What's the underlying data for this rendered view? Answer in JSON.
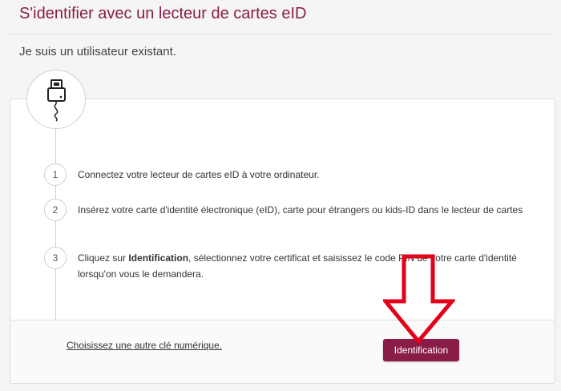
{
  "header": {
    "title": "S'identifier avec un lecteur de cartes eID",
    "subtitle": "Je suis un utilisateur existant."
  },
  "steps": [
    {
      "number": "1",
      "text": "Connectez votre lecteur de cartes eID à votre ordinateur."
    },
    {
      "number": "2",
      "text": "Insérez votre carte d'identité électronique (eID), carte pour étrangers ou kids-ID dans le lecteur de cartes"
    },
    {
      "number": "3",
      "text_before": "Cliquez sur ",
      "text_bold": "Identification",
      "text_after": ", sélectionnez votre certificat et saisissez le code PIN de votre carte d'identité lorsqu'on vous le demandera."
    }
  ],
  "footer": {
    "alt_link": "Choisissez une autre clé numérique.",
    "identify_button": "Identification"
  },
  "icons": {
    "card_reader": "card-reader-icon",
    "arrow": "red-down-arrow-icon"
  },
  "colors": {
    "brand": "#8a1c48",
    "arrow_red": "#e3001b"
  }
}
